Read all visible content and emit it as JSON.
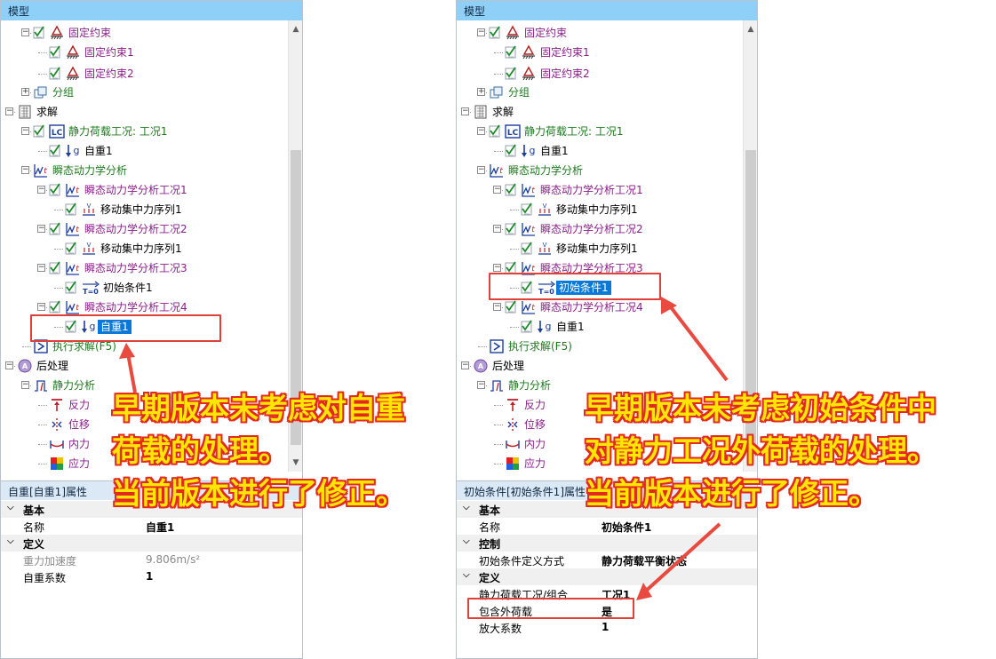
{
  "left": {
    "title": "模型",
    "tree": [
      {
        "label": "固定约束",
        "color": "purple"
      },
      {
        "label": "固定约束1",
        "color": "purple"
      },
      {
        "label": "固定约束2",
        "color": "purple"
      },
      {
        "label": "分组",
        "color": "green"
      },
      {
        "label": "求解",
        "color": "dark"
      },
      {
        "label": "静力荷载工况: 工况1",
        "color": "green"
      },
      {
        "label": "自重1",
        "color": "dark"
      },
      {
        "label": "瞬态动力学分析",
        "color": "green"
      },
      {
        "label": "瞬态动力学分析工况1",
        "color": "purple"
      },
      {
        "label": "移动集中力序列1",
        "color": "dark"
      },
      {
        "label": "瞬态动力学分析工况2",
        "color": "purple"
      },
      {
        "label": "移动集中力序列1",
        "color": "dark"
      },
      {
        "label": "瞬态动力学分析工况3",
        "color": "purple"
      },
      {
        "label": "初始条件1",
        "color": "dark"
      },
      {
        "label": "瞬态动力学分析工况4",
        "color": "purple"
      },
      {
        "label": "自重1",
        "color": "dark"
      },
      {
        "label": "执行求解(F5)",
        "color": "green"
      },
      {
        "label": "后处理",
        "color": "dark"
      },
      {
        "label": "静力分析",
        "color": "green"
      },
      {
        "label": "反力",
        "color": "purple"
      },
      {
        "label": "位移",
        "color": "purple"
      },
      {
        "label": "内力",
        "color": "purple"
      },
      {
        "label": "应力",
        "color": "purple"
      }
    ],
    "props_title": "自重[自重1]属性",
    "props": [
      {
        "key": "基本",
        "group": true
      },
      {
        "key": "名称",
        "value": "自重1"
      },
      {
        "key": "定义",
        "group": true
      },
      {
        "key": "重力加速度",
        "value": "9.806m/s²",
        "disabled": true
      },
      {
        "key": "自重系数",
        "value": "1"
      }
    ],
    "callout": [
      "早期版本未考虑对自重",
      "荷载的处理。",
      "当前版本进行了修正。"
    ]
  },
  "right": {
    "title": "模型",
    "tree": [
      {
        "label": "固定约束",
        "color": "purple"
      },
      {
        "label": "固定约束1",
        "color": "purple"
      },
      {
        "label": "固定约束2",
        "color": "purple"
      },
      {
        "label": "分组",
        "color": "green"
      },
      {
        "label": "求解",
        "color": "dark"
      },
      {
        "label": "静力荷载工况: 工况1",
        "color": "green"
      },
      {
        "label": "自重1",
        "color": "dark"
      },
      {
        "label": "瞬态动力学分析",
        "color": "green"
      },
      {
        "label": "瞬态动力学分析工况1",
        "color": "purple"
      },
      {
        "label": "移动集中力序列1",
        "color": "dark"
      },
      {
        "label": "瞬态动力学分析工况2",
        "color": "purple"
      },
      {
        "label": "移动集中力序列1",
        "color": "dark"
      },
      {
        "label": "瞬态动力学分析工况3",
        "color": "purple"
      },
      {
        "label": "初始条件1",
        "color": "dark"
      },
      {
        "label": "瞬态动力学分析工况4",
        "color": "purple"
      },
      {
        "label": "自重1",
        "color": "dark"
      },
      {
        "label": "执行求解(F5)",
        "color": "green"
      },
      {
        "label": "后处理",
        "color": "dark"
      },
      {
        "label": "静力分析",
        "color": "green"
      },
      {
        "label": "反力",
        "color": "purple"
      },
      {
        "label": "位移",
        "color": "purple"
      },
      {
        "label": "内力",
        "color": "purple"
      },
      {
        "label": "应力",
        "color": "purple"
      }
    ],
    "props_title": "初始条件[初始条件1]属性",
    "props": [
      {
        "key": "基本",
        "group": true
      },
      {
        "key": "名称",
        "value": "初始条件1"
      },
      {
        "key": "控制",
        "group": true
      },
      {
        "key": "初始条件定义方式",
        "value": "静力荷载平衡状态"
      },
      {
        "key": "定义",
        "group": true
      },
      {
        "key": "静力荷载工况/组合",
        "value": "工况1"
      },
      {
        "key": "包含外荷载",
        "value": "是"
      },
      {
        "key": "放大系数",
        "value": "1"
      }
    ],
    "callout": [
      "早期版本未考虑初始条件中",
      "对静力工况外荷载的处理。",
      "当前版本进行了修正。"
    ]
  },
  "colors": {
    "title_bar": "#8fd0f8",
    "selection": "#0a78d7",
    "callout_text": "#ffe600",
    "callout_outline": "#e32a22",
    "highlight_box": "#e0403a"
  }
}
